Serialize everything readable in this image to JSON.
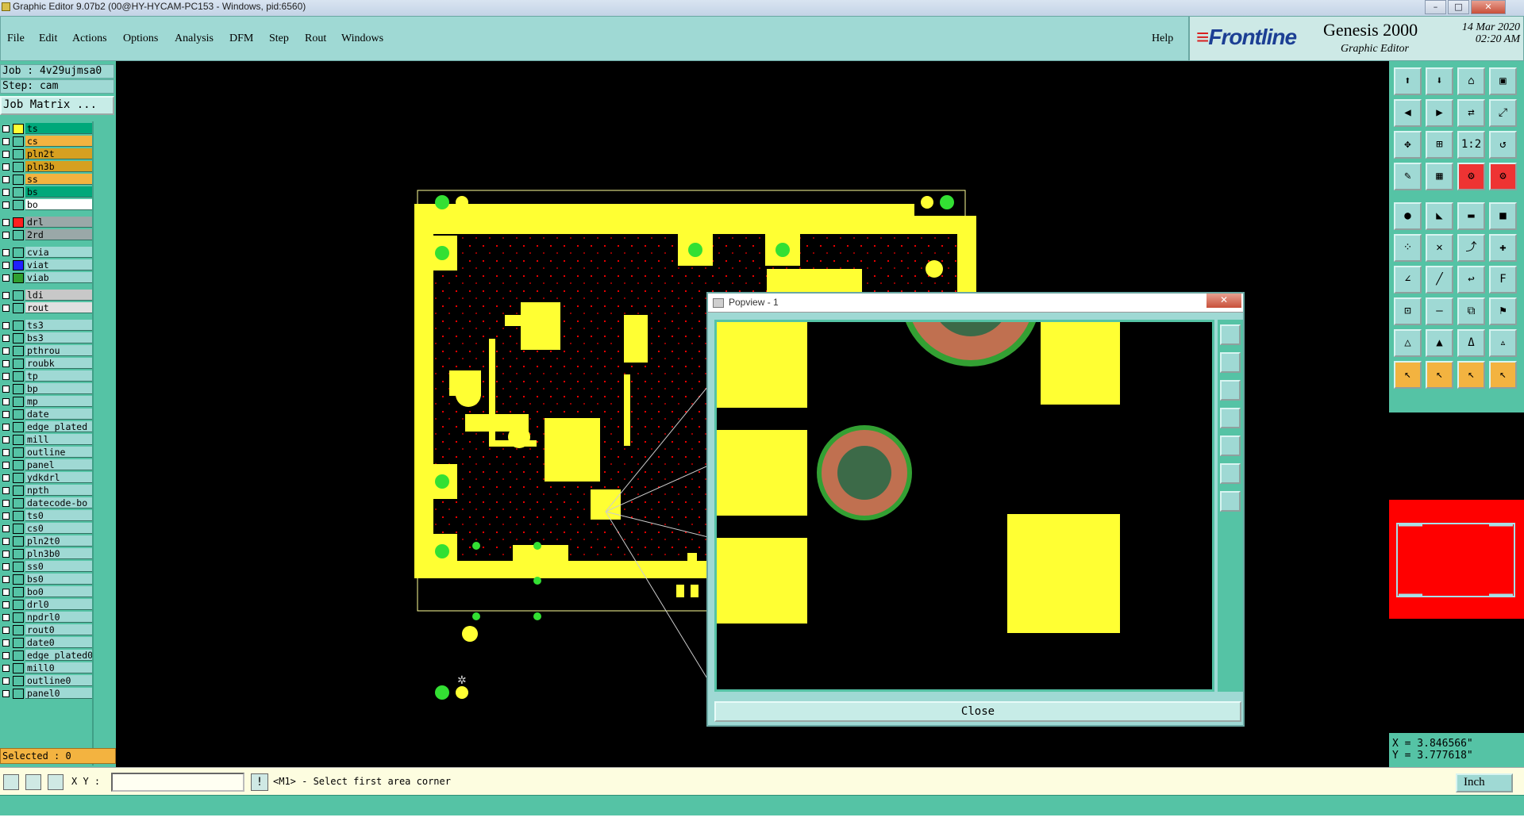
{
  "window": {
    "title": "Graphic Editor 9.07b2 (00@HY-HYCAM-PC153 - Windows, pid:6560)",
    "minimize": "–",
    "restore": "□",
    "close": "✕"
  },
  "menu": {
    "items": [
      "File",
      "Edit",
      "Actions",
      "Options",
      "Analysis",
      "DFM",
      "Step",
      "Rout",
      "Windows"
    ],
    "help": "Help"
  },
  "brand": {
    "logo_main": "Frontline",
    "product": "Genesis 2000",
    "subtitle": "Graphic Editor",
    "date": "14 Mar 2020",
    "time": "02:20 AM"
  },
  "job": {
    "job_label": "Job : 4v29ujmsa0",
    "step_label": "Step: cam",
    "matrix_button": "Job Matrix ..."
  },
  "layers": [
    {
      "name": "ts",
      "color": "#ffff33",
      "bg": "#00a87a"
    },
    {
      "name": "cs",
      "color": "",
      "bg": "#f3b340"
    },
    {
      "name": "pln2t",
      "color": "",
      "bg": "#d6a020"
    },
    {
      "name": "pln3b",
      "color": "",
      "bg": "#d6a020"
    },
    {
      "name": "ss",
      "color": "",
      "bg": "#f3b340"
    },
    {
      "name": "bs",
      "color": "",
      "bg": "#00a87a"
    },
    {
      "name": "bo",
      "color": "",
      "bg": "#ffffff"
    },
    {
      "name": "drl",
      "color": "#ff2020",
      "bg": "#9aa8a8"
    },
    {
      "name": "2rd",
      "color": "",
      "bg": "#9aa8a8"
    },
    {
      "name": "cvia",
      "color": "",
      "bg": "#9fd9d4"
    },
    {
      "name": "viat",
      "color": "#2020ff",
      "bg": "#9fd9d4"
    },
    {
      "name": "viab",
      "color": "#30a030",
      "bg": "#9fd9d4"
    },
    {
      "name": "ldi",
      "color": "",
      "bg": "#c8c8c8"
    },
    {
      "name": "rout",
      "color": "",
      "bg": "#e0e0e0"
    },
    {
      "name": "ts3",
      "color": "",
      "bg": "#9fd9d4"
    },
    {
      "name": "bs3",
      "color": "",
      "bg": "#9fd9d4"
    },
    {
      "name": "pthrou",
      "color": "",
      "bg": "#9fd9d4"
    },
    {
      "name": "roubk",
      "color": "",
      "bg": "#9fd9d4"
    },
    {
      "name": "tp",
      "color": "",
      "bg": "#9fd9d4"
    },
    {
      "name": "bp",
      "color": "",
      "bg": "#9fd9d4"
    },
    {
      "name": "mp",
      "color": "",
      "bg": "#9fd9d4"
    },
    {
      "name": "date",
      "color": "",
      "bg": "#9fd9d4"
    },
    {
      "name": "edge_plated",
      "color": "",
      "bg": "#9fd9d4"
    },
    {
      "name": "mill",
      "color": "",
      "bg": "#9fd9d4"
    },
    {
      "name": "outline",
      "color": "",
      "bg": "#9fd9d4"
    },
    {
      "name": "panel",
      "color": "",
      "bg": "#9fd9d4"
    },
    {
      "name": "ydkdrl",
      "color": "",
      "bg": "#9fd9d4"
    },
    {
      "name": "npth",
      "color": "",
      "bg": "#9fd9d4"
    },
    {
      "name": "datecode-bo",
      "color": "",
      "bg": "#9fd9d4"
    },
    {
      "name": "ts0",
      "color": "",
      "bg": "#9fd9d4"
    },
    {
      "name": "cs0",
      "color": "",
      "bg": "#9fd9d4"
    },
    {
      "name": "pln2t0",
      "color": "",
      "bg": "#9fd9d4"
    },
    {
      "name": "pln3b0",
      "color": "",
      "bg": "#9fd9d4"
    },
    {
      "name": "ss0",
      "color": "",
      "bg": "#9fd9d4"
    },
    {
      "name": "bs0",
      "color": "",
      "bg": "#9fd9d4"
    },
    {
      "name": "bo0",
      "color": "",
      "bg": "#9fd9d4"
    },
    {
      "name": "drl0",
      "color": "",
      "bg": "#9fd9d4"
    },
    {
      "name": "npdrl0",
      "color": "",
      "bg": "#9fd9d4"
    },
    {
      "name": "rout0",
      "color": "",
      "bg": "#9fd9d4"
    },
    {
      "name": "date0",
      "color": "",
      "bg": "#9fd9d4"
    },
    {
      "name": "edge_plated0",
      "color": "",
      "bg": "#9fd9d4"
    },
    {
      "name": "mill0",
      "color": "",
      "bg": "#9fd9d4"
    },
    {
      "name": "outline0",
      "color": "",
      "bg": "#9fd9d4"
    },
    {
      "name": "panel0",
      "color": "",
      "bg": "#9fd9d4"
    }
  ],
  "selected": "Selected : 0",
  "bottom": {
    "xy_label": "X Y :",
    "xy_value": "",
    "prompt": "<M1> - Select first area corner",
    "units": "Inch"
  },
  "coords": {
    "x": "X = 3.846566\"",
    "y": "Y = 3.777618\""
  },
  "popview": {
    "title": "Popview - 1",
    "close_label": "Close"
  },
  "colors": {
    "copper": "#ffff33",
    "pad_green": "#33e033",
    "drill_red": "#ff0000",
    "panel_teal": "#55c3a5",
    "menu_teal": "#9fd9d4"
  }
}
